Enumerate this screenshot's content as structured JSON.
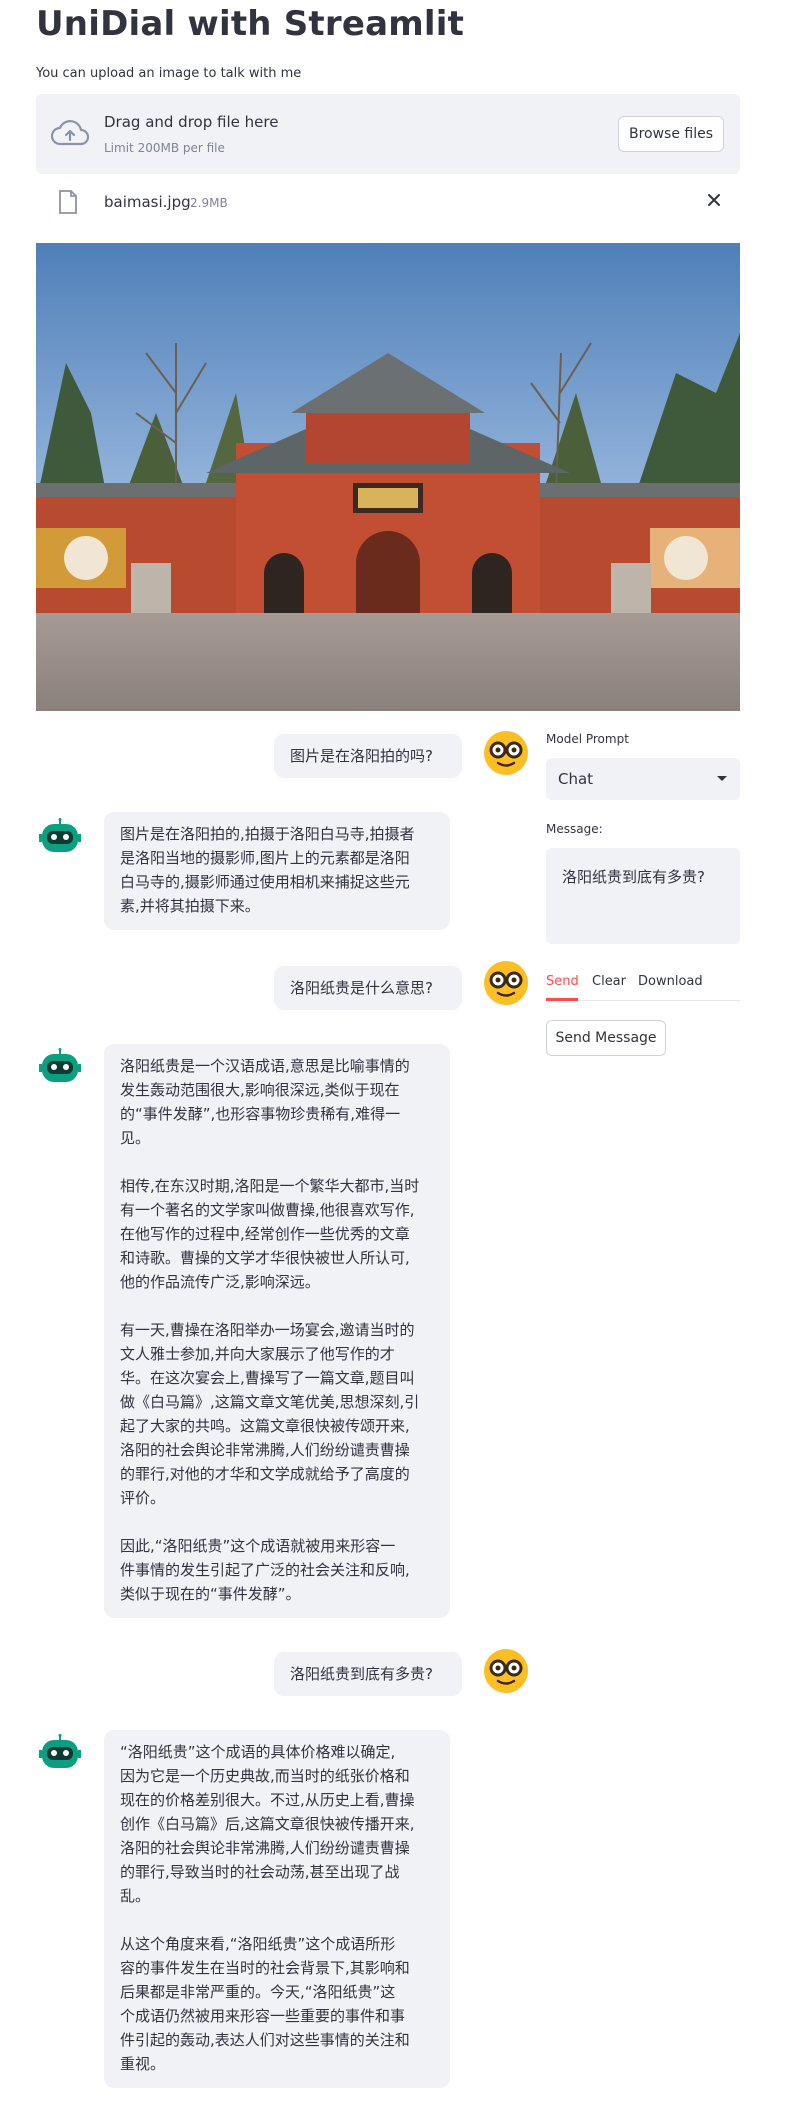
{
  "header": {
    "title": "UniDial with Streamlit",
    "subtitle": "You can upload an image to talk with me"
  },
  "uploader": {
    "drop_text": "Drag and drop file here",
    "limit_text": "Limit 200MB per file",
    "browse_label": "Browse files",
    "file_name": "baimasi.jpg",
    "file_size": "2.9MB"
  },
  "chat": [
    {
      "role": "user",
      "text": "图片是在洛阳拍的吗?"
    },
    {
      "role": "assistant",
      "text": "图片是在洛阳拍的,拍摄于洛阳白马寺,拍摄者\n是洛阳当地的摄影师,图片上的元素都是洛阳\n白马寺的,摄影师通过使用相机来捕捉这些元\n素,并将其拍摄下来。"
    },
    {
      "role": "user",
      "text": "洛阳纸贵是什么意思?"
    },
    {
      "role": "assistant",
      "text": "洛阳纸贵是一个汉语成语,意思是比喻事情的\n发生轰动范围很大,影响很深远,类似于现在\n的“事件发酵”,也形容事物珍贵稀有,难得一\n见。\n\n相传,在东汉时期,洛阳是一个繁华大都市,当时\n有一个著名的文学家叫做曹操,他很喜欢写作,\n在他写作的过程中,经常创作一些优秀的文章\n和诗歌。曹操的文学才华很快被世人所认可,\n他的作品流传广泛,影响深远。\n\n有一天,曹操在洛阳举办一场宴会,邀请当时的\n文人雅士参加,并向大家展示了他写作的才\n华。在这次宴会上,曹操写了一篇文章,题目叫\n做《白马篇》,这篇文章文笔优美,思想深刻,引\n起了大家的共鸣。这篇文章很快被传颂开来,\n洛阳的社会舆论非常沸腾,人们纷纷谴责曹操\n的罪行,对他的才华和文学成就给予了高度的\n评价。\n\n因此,“洛阳纸贵”这个成语就被用来形容一\n件事情的发生引起了广泛的社会关注和反响,\n类似于现在的“事件发酵”。"
    },
    {
      "role": "user",
      "text": "洛阳纸贵到底有多贵?"
    },
    {
      "role": "assistant",
      "text": "“洛阳纸贵”这个成语的具体价格难以确定,\n因为它是一个历史典故,而当时的纸张价格和\n现在的价格差别很大。不过,从历史上看,曹操\n创作《白马篇》后,这篇文章很快被传播开来,\n洛阳的社会舆论非常沸腾,人们纷纷谴责曹操\n的罪行,导致当时的社会动荡,甚至出现了战\n乱。\n\n从这个角度来看,“洛阳纸贵”这个成语所形\n容的事件发生在当时的社会背景下,其影响和\n后果都是非常严重的。今天,“洛阳纸贵”这\n个成语仍然被用来形容一些重要的事件和事\n件引起的轰动,表达人们对这些事情的关注和\n重视。"
    }
  ],
  "sidebar": {
    "model_prompt_label": "Model Prompt",
    "model_prompt_value": "Chat",
    "message_label": "Message:",
    "message_value": "洛阳纸贵到底有多贵?",
    "tabs": [
      "Send",
      "Clear",
      "Download"
    ],
    "send_button": "Send Message"
  },
  "colors": {
    "accent": "#ff4b4b",
    "bubble": "#f0f2f6",
    "text": "#31333f",
    "user_avatar": "#fbbf24",
    "bot_avatar": "#0b9e7f"
  },
  "icons": [
    "cloud-upload-icon",
    "file-icon",
    "close-icon",
    "chevron-down-icon",
    "nerd-face-icon",
    "robot-icon"
  ]
}
